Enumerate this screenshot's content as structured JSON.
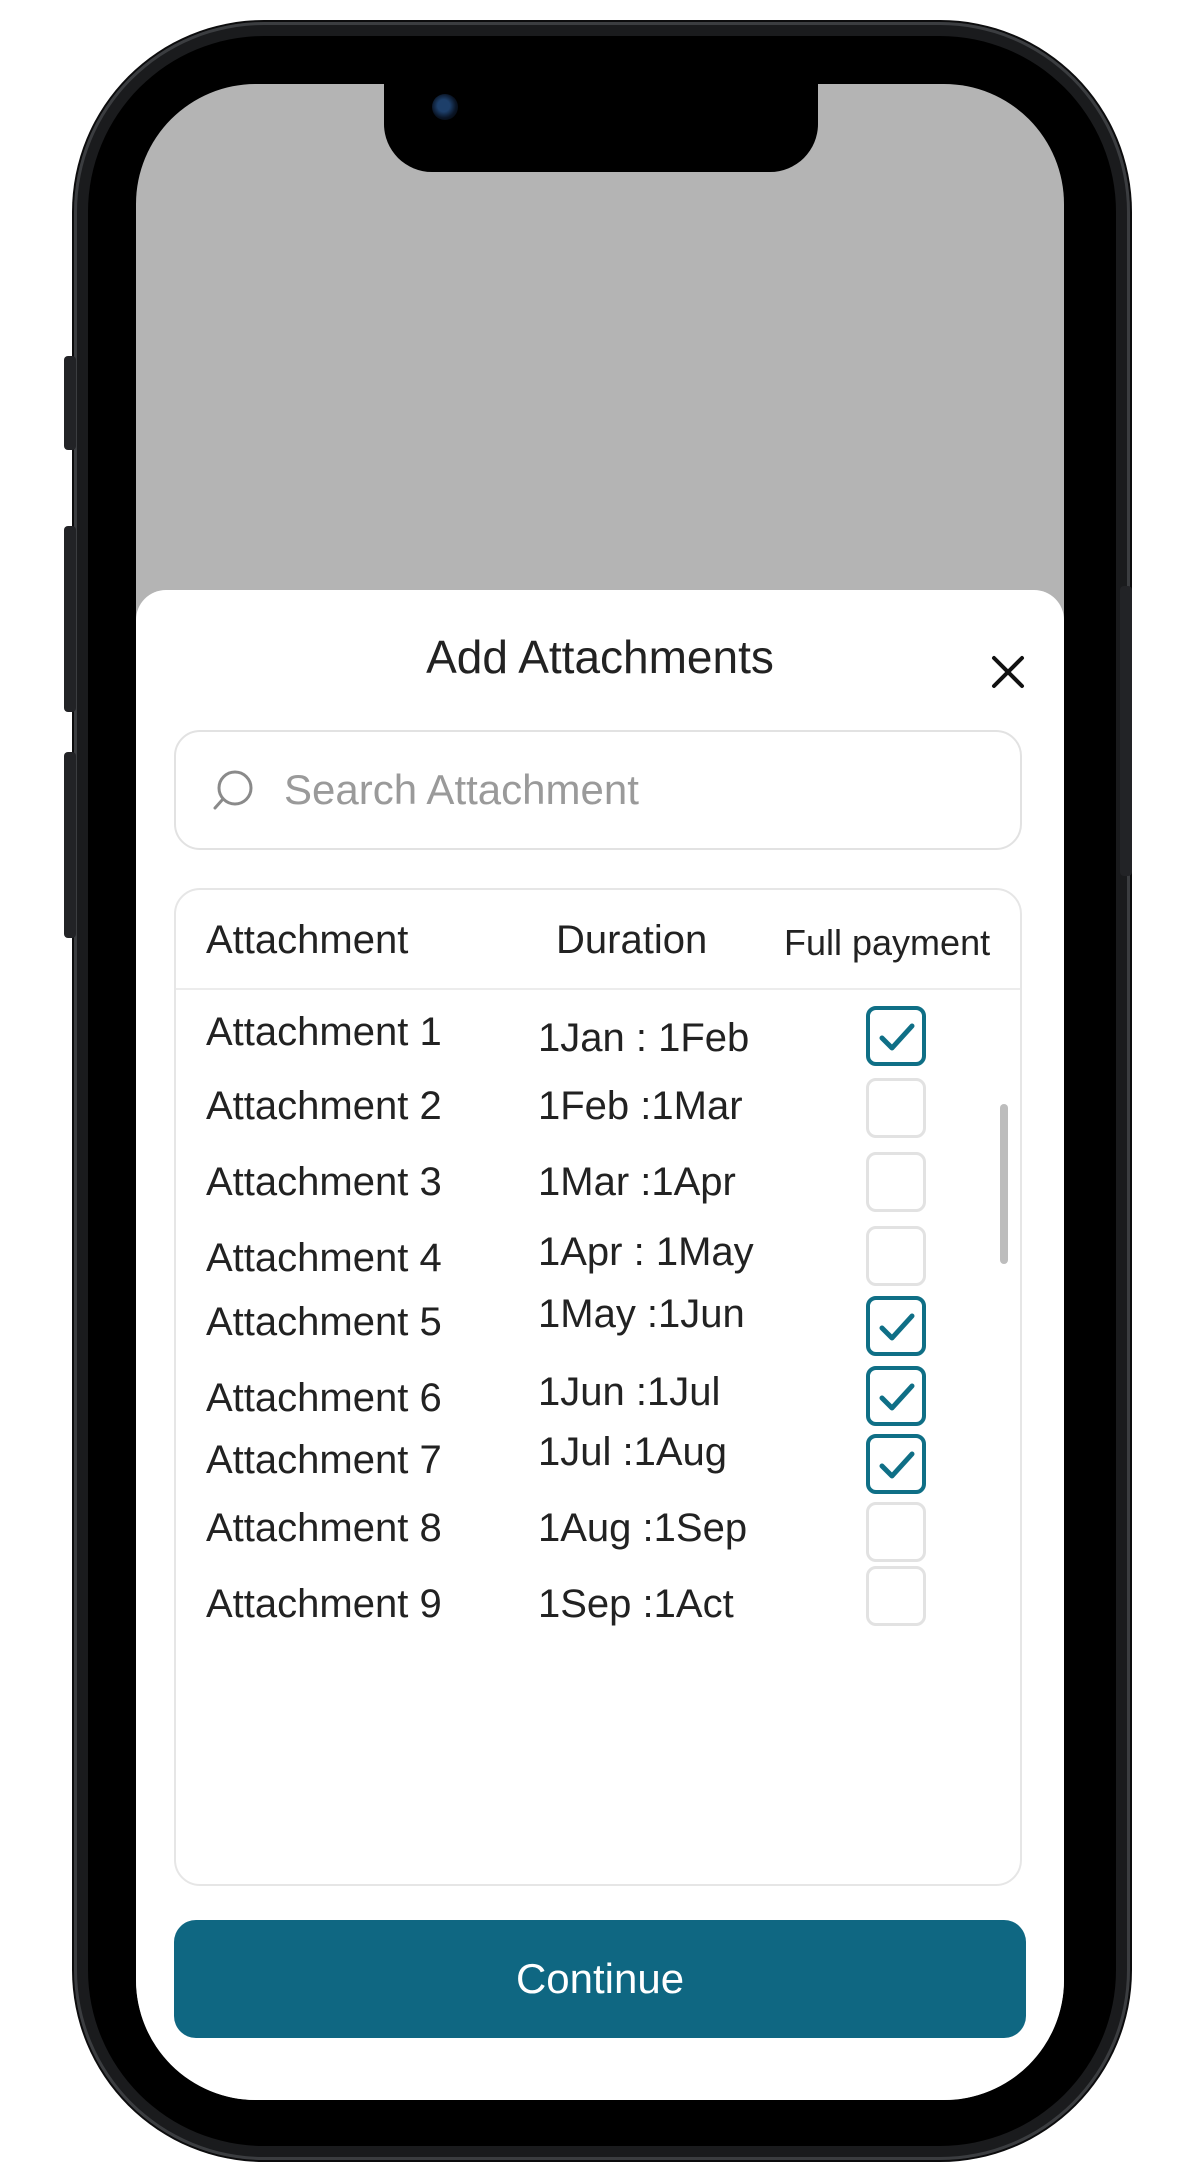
{
  "sheet": {
    "title": "Add Attachments",
    "close_icon": "close-icon"
  },
  "search": {
    "placeholder": "Search Attachment",
    "value": "",
    "icon": "search-icon"
  },
  "table": {
    "headers": {
      "attachment": "Attachment",
      "duration": "Duration",
      "full_payment": "Full payment"
    },
    "rows": [
      {
        "name": "Attachment 1",
        "duration": "1Jan : 1Feb",
        "full_payment": true
      },
      {
        "name": "Attachment 2",
        "duration": "1Feb :1Mar",
        "full_payment": false
      },
      {
        "name": "Attachment 3",
        "duration": "1Mar :1Apr",
        "full_payment": false
      },
      {
        "name": "Attachment 4",
        "duration": "1Apr : 1May",
        "full_payment": false
      },
      {
        "name": "Attachment 5",
        "duration": "1May :1Jun",
        "full_payment": true
      },
      {
        "name": "Attachment 6",
        "duration": "1Jun :1Jul",
        "full_payment": true
      },
      {
        "name": "Attachment 7",
        "duration": "1Jul :1Aug",
        "full_payment": true
      },
      {
        "name": "Attachment 8",
        "duration": "1Aug :1Sep",
        "full_payment": false
      },
      {
        "name": "Attachment 9",
        "duration": "1Sep :1Act",
        "full_payment": false
      }
    ]
  },
  "footer": {
    "continue_label": "Continue"
  },
  "colors": {
    "accent": "#0f6782",
    "check_border": "#0f6f86",
    "backdrop": "#b4b4b4"
  }
}
